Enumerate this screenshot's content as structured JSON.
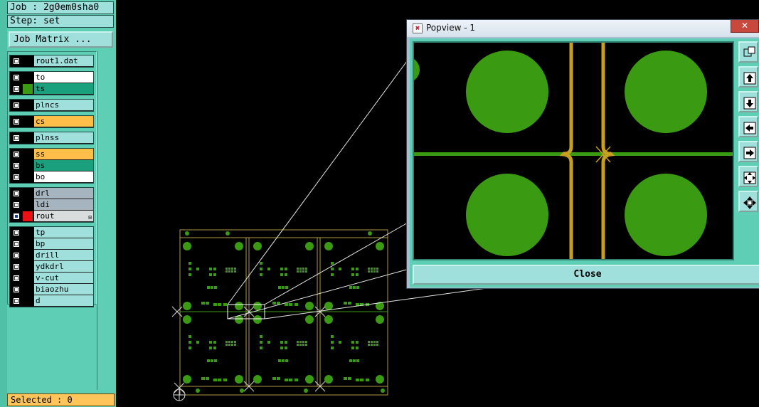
{
  "left_panel": {
    "job": "Job : 2g0em0sha0",
    "step": "Step: set",
    "matrix_button": "Job Matrix ...",
    "selected": "Selected : 0",
    "groups": [
      [
        {
          "name": "rout1.dat",
          "swatch": "#000000",
          "bg": "#9fe0dc",
          "checked": false
        }
      ],
      [
        {
          "name": "to",
          "swatch": "#000000",
          "bg": "#ffffff",
          "checked": false
        },
        {
          "name": "ts",
          "swatch": "#3a9a12",
          "bg": "#1aa07c",
          "checked": false
        }
      ],
      [
        {
          "name": "plncs",
          "swatch": "#000000",
          "bg": "#9fe0dc",
          "checked": false
        }
      ],
      [
        {
          "name": "cs",
          "swatch": "#000000",
          "bg": "#ffbd4a",
          "checked": false
        }
      ],
      [
        {
          "name": "plnss",
          "swatch": "#000000",
          "bg": "#9fe0dc",
          "checked": false
        }
      ],
      [
        {
          "name": "ss",
          "swatch": "#000000",
          "bg": "#ffbd4a",
          "checked": false
        },
        {
          "name": "bs",
          "swatch": "#000000",
          "bg": "#1aa07c",
          "checked": false
        },
        {
          "name": "bo",
          "swatch": "#000000",
          "bg": "#ffffff",
          "checked": false
        }
      ],
      [
        {
          "name": "drl",
          "swatch": "#000000",
          "bg": "#a6b4bf",
          "checked": false
        },
        {
          "name": "ldi",
          "swatch": "#000000",
          "bg": "#a6b4bf",
          "checked": false
        },
        {
          "name": "rout",
          "swatch": "#ee1111",
          "bg": "#d8dcdc",
          "checked": true,
          "expand": "⊞"
        }
      ],
      [
        {
          "name": "tp",
          "swatch": "#000000",
          "bg": "#9fe0dc",
          "checked": false
        },
        {
          "name": "bp",
          "swatch": "#000000",
          "bg": "#9fe0dc",
          "checked": false
        },
        {
          "name": "drill",
          "swatch": "#000000",
          "bg": "#9fe0dc",
          "checked": false
        },
        {
          "name": "ydkdrl",
          "swatch": "#000000",
          "bg": "#9fe0dc",
          "checked": false
        },
        {
          "name": "v-cut",
          "swatch": "#000000",
          "bg": "#9fe0dc",
          "checked": false
        },
        {
          "name": "biaozhu",
          "swatch": "#000000",
          "bg": "#9fe0dc",
          "checked": false
        },
        {
          "name": "d",
          "swatch": "#000000",
          "bg": "#9fe0dc",
          "checked": false
        }
      ]
    ]
  },
  "popview": {
    "title": "Popview - 1",
    "close_x": "✕",
    "close_button": "Close",
    "tools": [
      "zoom-fit-icon",
      "move-up-icon",
      "move-down-icon",
      "move-left-icon",
      "move-right-icon",
      "zoom-in-icon",
      "pan-all-icon"
    ]
  },
  "colors": {
    "panel": "#5ecfb4",
    "pad_green": "#3a9a12",
    "rout_gold": "#c8a020",
    "board_outline": "#b09a40"
  }
}
